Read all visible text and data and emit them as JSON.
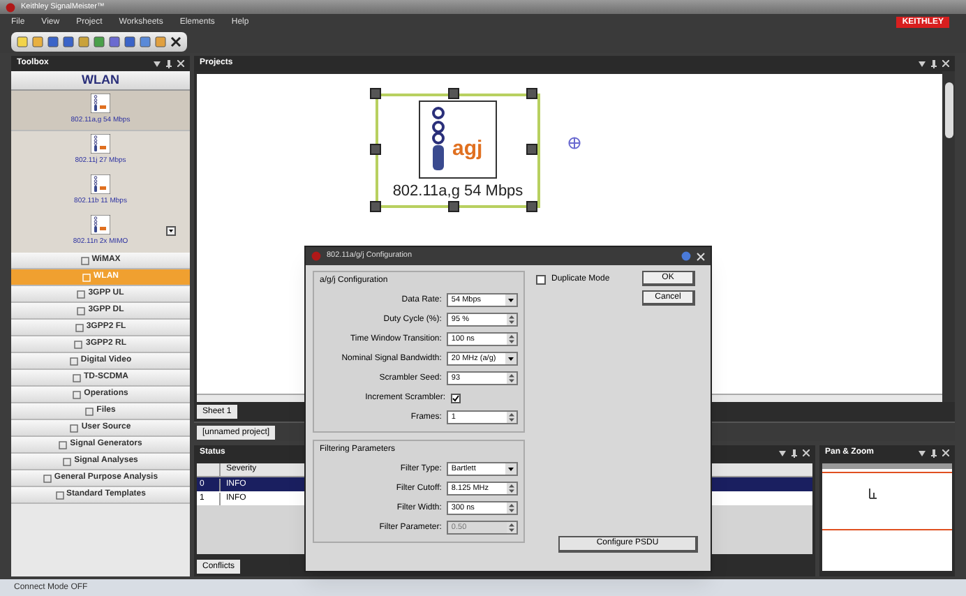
{
  "window": {
    "title": "Keithley SignalMeister™",
    "logo": "KEITHLEY"
  },
  "menu": [
    "File",
    "View",
    "Project",
    "Worksheets",
    "Elements",
    "Help"
  ],
  "toolbox": {
    "title": "Toolbox",
    "group": "WLAN",
    "items": [
      {
        "label": "802.11a,g 54 Mbps",
        "selected": true
      },
      {
        "label": "802.11j 27 Mbps",
        "selected": false
      },
      {
        "label": "802.11b 11 Mbps",
        "selected": false
      },
      {
        "label": "802.11n 2x MIMO",
        "selected": false
      }
    ],
    "categories": [
      {
        "label": "WiMAX",
        "selected": false
      },
      {
        "label": "WLAN",
        "selected": true
      },
      {
        "label": "3GPP UL",
        "selected": false
      },
      {
        "label": "3GPP DL",
        "selected": false
      },
      {
        "label": "3GPP2 FL",
        "selected": false
      },
      {
        "label": "3GPP2 RL",
        "selected": false
      },
      {
        "label": "Digital Video",
        "selected": false
      },
      {
        "label": "TD-SCDMA",
        "selected": false
      },
      {
        "label": "Operations",
        "selected": false
      },
      {
        "label": "Files",
        "selected": false
      },
      {
        "label": "User Source",
        "selected": false
      },
      {
        "label": "Signal Generators",
        "selected": false
      },
      {
        "label": "Signal Analyses",
        "selected": false
      },
      {
        "label": "General Purpose Analysis",
        "selected": false
      },
      {
        "label": "Standard Templates",
        "selected": false
      }
    ]
  },
  "projects": {
    "title": "Projects",
    "node": {
      "badge": "agj",
      "label": "802.11a,g 54 Mbps"
    },
    "sheet_tabs": [
      {
        "label": "Sheet 1",
        "selected": true
      }
    ],
    "project_tabs": [
      {
        "label": "[unnamed project]",
        "selected": true
      }
    ]
  },
  "status": {
    "title": "Status",
    "columns": [
      "Severity"
    ],
    "rows": [
      {
        "index": "0",
        "severity": "INFO",
        "selected": true
      },
      {
        "index": "1",
        "severity": "INFO",
        "selected": false
      }
    ],
    "tabs": [
      {
        "label": "Conflicts",
        "selected": true
      }
    ]
  },
  "pan_zoom": {
    "title": "Pan & Zoom"
  },
  "dialog": {
    "title": "802.11a/g/j Configuration",
    "groups": [
      {
        "title": "a/g/j Configuration",
        "fields": [
          {
            "label": "Data Rate:",
            "kind": "dropdown",
            "value": "54 Mbps",
            "disabled": false
          },
          {
            "label": "Duty Cycle (%):",
            "kind": "spin",
            "value": "95 %",
            "disabled": false
          },
          {
            "label": "Time Window Transition:",
            "kind": "spin",
            "value": "100 ns",
            "disabled": false
          },
          {
            "label": "Nominal Signal Bandwidth:",
            "kind": "dropdown",
            "value": "20 MHz (a/g)",
            "disabled": false
          },
          {
            "label": "Scrambler Seed:",
            "kind": "spin",
            "value": "93",
            "disabled": false
          },
          {
            "label": "Increment Scrambler:",
            "kind": "checkbox",
            "checked": true
          },
          {
            "label": "Frames:",
            "kind": "spin",
            "value": "1",
            "disabled": false
          }
        ]
      },
      {
        "title": "Filtering Parameters",
        "fields": [
          {
            "label": "Filter Type:",
            "kind": "dropdown",
            "value": "Bartlett",
            "disabled": false
          },
          {
            "label": "Filter Cutoff:",
            "kind": "spin",
            "value": "8.125 MHz",
            "disabled": false
          },
          {
            "label": "Filter Width:",
            "kind": "spin",
            "value": "300 ns",
            "disabled": false
          },
          {
            "label": "Filter Parameter:",
            "kind": "spin",
            "value": "0.50",
            "disabled": true
          }
        ]
      }
    ],
    "duplicate_mode": {
      "label": "Duplicate Mode",
      "checked": false
    },
    "buttons": [
      "OK",
      "Cancel"
    ],
    "configure_button": "Configure PSDU"
  },
  "status_bar": "Connect Mode OFF"
}
